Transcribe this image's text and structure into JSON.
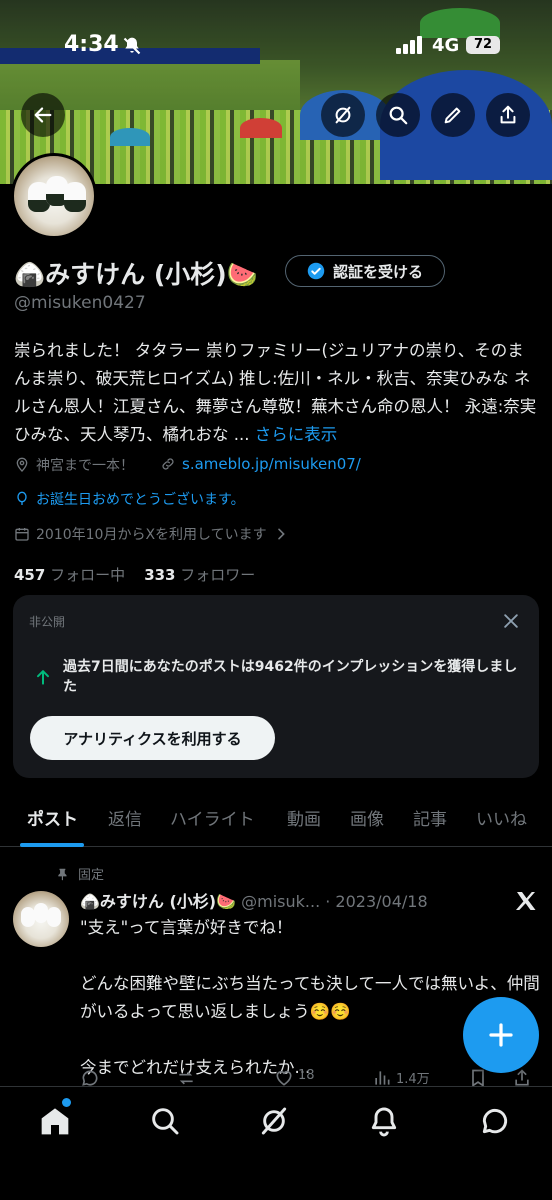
{
  "status_bar": {
    "time": "4:34",
    "network": "4G",
    "battery": "72"
  },
  "profile": {
    "name": "🍙みすけん (小杉)🍉",
    "handle": "@misuken0427",
    "verify_button": "認証を受ける",
    "bio": "崇られました！ タタラー 崇りファミリー(ジュリアナの崇り、そのまんま崇り、破天荒ヒロイズム) 推し:佐川・ネル・秋吉、奈実ひみな ネルさん恩人！江夏さん、舞夢さん尊敬！蕪木さん命の恩人！ 永遠:奈実ひみな、天人琴乃、橘れおな ...",
    "bio_more": "さらに表示",
    "location": "神宮まで一本！",
    "website": "s.ameblo.jp/misuken07/",
    "birthday": "お誕生日おめでとうございます。",
    "joined": "2010年10月からXを利用しています",
    "following_count": "457",
    "following_label": "フォロー中",
    "followers_count": "333",
    "followers_label": "フォロワー"
  },
  "private_card": {
    "label": "非公開",
    "message": "過去7日間にあなたのポストは9462件のインプレッションを獲得しました",
    "button": "アナリティクスを利用する"
  },
  "tabs": [
    "ポスト",
    "返信",
    "ハイライト",
    "動画",
    "画像",
    "記事",
    "いいね"
  ],
  "pinned_post": {
    "pinned_label": "固定",
    "author": "🍙みすけん (小杉)🍉",
    "meta": "@misuk... · 2023/04/18",
    "body": "\"支え\"って言葉が好きでね！\n\nどんな困難や壁にぶち当たっても決して一人では無いよ、仲間がいるよって思い返しましょう☺️☺️\n\n今までどれだけ支えられたか...",
    "likes": "18",
    "views": "1.4万"
  },
  "colors": {
    "accent": "#1d9bf0",
    "background": "#000000",
    "card": "#16181c",
    "muted": "#71767b"
  },
  "icons": {
    "back": "arrow-left-icon",
    "grok": "grok-icon",
    "search": "search-icon",
    "edit": "pencil-icon",
    "share": "share-icon"
  }
}
